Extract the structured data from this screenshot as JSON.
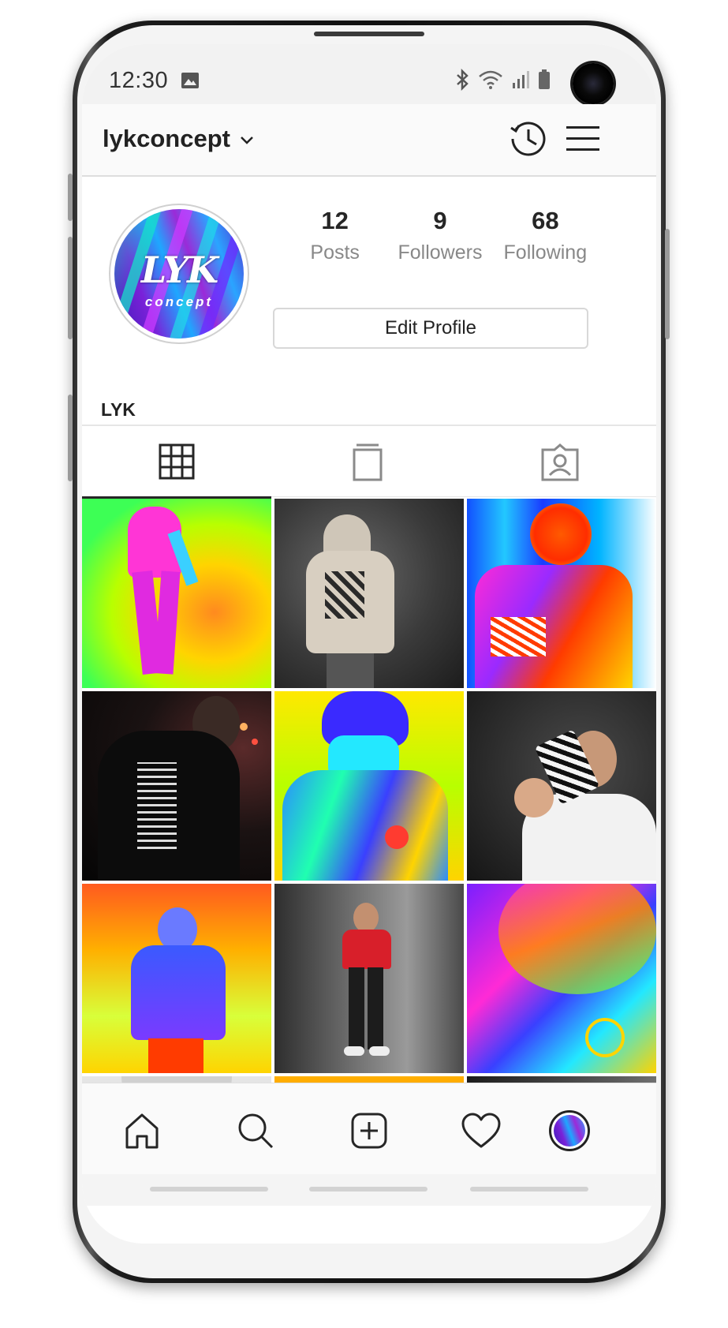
{
  "status_bar": {
    "time": "12:30",
    "icons": [
      "image-icon",
      "bluetooth-icon",
      "wifi-icon",
      "signal-icon",
      "battery-icon"
    ]
  },
  "header": {
    "username": "lykconcept",
    "icons": [
      "chevron-down-icon",
      "history-icon",
      "menu-icon"
    ]
  },
  "profile": {
    "avatar_logo": "LYK",
    "avatar_sub": "concept",
    "stats": [
      {
        "value": "12",
        "label": "Posts"
      },
      {
        "value": "9",
        "label": "Followers"
      },
      {
        "value": "68",
        "label": "Following"
      }
    ],
    "edit_button": "Edit Profile",
    "display_name": "LYK"
  },
  "tabs": [
    {
      "icon": "grid-icon",
      "active": true
    },
    {
      "icon": "igtv-icon",
      "active": false
    },
    {
      "icon": "tagged-icon",
      "active": false
    }
  ],
  "posts": [
    {
      "name": "post-thermal-figure-standing"
    },
    {
      "name": "post-beige-hoodie-back"
    },
    {
      "name": "post-thermal-man-back"
    },
    {
      "name": "post-black-hoodie-night"
    },
    {
      "name": "post-thermal-hoodie-front"
    },
    {
      "name": "post-man-holding-phone-case"
    },
    {
      "name": "post-thermal-hoodie-studio"
    },
    {
      "name": "post-red-tshirt-studio"
    },
    {
      "name": "post-thermal-closeup"
    },
    {
      "name": "post-grey-hoodie"
    },
    {
      "name": "post-thermal-partial"
    },
    {
      "name": "post-studio-partial"
    }
  ],
  "bottom_nav": [
    "home-icon",
    "search-icon",
    "new-post-icon",
    "activity-heart-icon",
    "profile-avatar"
  ],
  "colors": {
    "text_primary": "#262626",
    "text_secondary": "#888888",
    "divider": "#dedede",
    "background": "#ffffff"
  }
}
